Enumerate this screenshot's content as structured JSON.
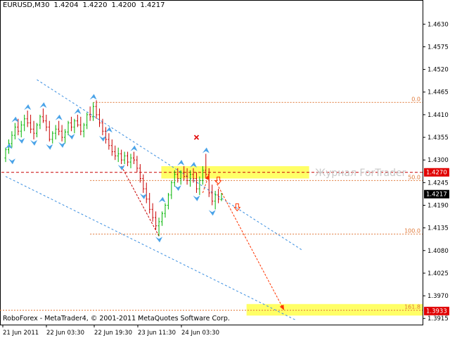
{
  "header": {
    "symbol": "EURUSD,M30",
    "open": "1.4204",
    "high": "1.4220",
    "low": "1.4200",
    "close": "1.4217"
  },
  "footer": {
    "copyright": "RoboForex - MetaTrader4, © 2001-2011 MetaQuotes Software Corp."
  },
  "watermark": "Журнал ForTrader",
  "colors": {
    "up": "#00b400",
    "down": "#c80000",
    "fractal": "#4aa3e8",
    "level": "#e07a3a",
    "channel": "#3a8ee0",
    "arrow": "#ff3300",
    "highlight": "#ffff66"
  },
  "chart_data": {
    "type": "candlestick",
    "y_ticks": [
      "1.4630",
      "1.4575",
      "1.4520",
      "1.4465",
      "1.4410",
      "1.4355",
      "1.4300",
      "1.4245",
      "1.4190",
      "1.4135",
      "1.4080",
      "1.4025",
      "1.3970",
      "1.3915"
    ],
    "ylim": [
      1.39,
      1.4675
    ],
    "x_ticks": [
      "21 Jun 2011",
      "22 Jun 03:30",
      "22 Jun 19:30",
      "23 Jun 11:30",
      "24 Jun 03:30"
    ],
    "price_labels": [
      {
        "value": 1.427,
        "text": "1.4270",
        "style": "red"
      },
      {
        "value": 1.4217,
        "text": "1.4217",
        "style": "black"
      },
      {
        "value": 1.3933,
        "text": "1.3933",
        "style": "red"
      }
    ],
    "fib_levels": [
      {
        "value": 1.444,
        "label": "0.0"
      },
      {
        "value": 1.425,
        "label": "50.0"
      },
      {
        "value": 1.412,
        "label": "100.0"
      },
      {
        "value": 1.3935,
        "label": "161.8"
      }
    ],
    "candles": [
      [
        1.4305,
        1.433,
        1.4295,
        1.4325
      ],
      [
        1.4325,
        1.435,
        1.4315,
        1.434
      ],
      [
        1.434,
        1.437,
        1.433,
        1.436
      ],
      [
        1.436,
        1.439,
        1.435,
        1.438
      ],
      [
        1.438,
        1.44,
        1.436,
        1.437
      ],
      [
        1.437,
        1.4395,
        1.4355,
        1.4385
      ],
      [
        1.4385,
        1.441,
        1.437,
        1.44
      ],
      [
        1.44,
        1.442,
        1.438,
        1.439
      ],
      [
        1.439,
        1.441,
        1.4365,
        1.4375
      ],
      [
        1.4375,
        1.4395,
        1.435,
        1.4365
      ],
      [
        1.4365,
        1.439,
        1.4355,
        1.4385
      ],
      [
        1.4385,
        1.441,
        1.4375,
        1.4405
      ],
      [
        1.4405,
        1.4425,
        1.439,
        1.4395
      ],
      [
        1.4395,
        1.441,
        1.437,
        1.438
      ],
      [
        1.438,
        1.4395,
        1.4345,
        1.435
      ],
      [
        1.435,
        1.437,
        1.434,
        1.4365
      ],
      [
        1.4365,
        1.4385,
        1.435,
        1.4375
      ],
      [
        1.4375,
        1.4395,
        1.436,
        1.437
      ],
      [
        1.437,
        1.4385,
        1.4345,
        1.4355
      ],
      [
        1.4355,
        1.4375,
        1.434,
        1.4368
      ],
      [
        1.4368,
        1.4395,
        1.436,
        1.439
      ],
      [
        1.439,
        1.4405,
        1.437,
        1.438
      ],
      [
        1.438,
        1.44,
        1.4365,
        1.4395
      ],
      [
        1.4395,
        1.441,
        1.438,
        1.4385
      ],
      [
        1.4385,
        1.4405,
        1.436,
        1.437
      ],
      [
        1.437,
        1.439,
        1.4355,
        1.4385
      ],
      [
        1.4385,
        1.4415,
        1.4375,
        1.441
      ],
      [
        1.441,
        1.443,
        1.4395,
        1.4405
      ],
      [
        1.4405,
        1.444,
        1.4395,
        1.443
      ],
      [
        1.443,
        1.4445,
        1.44,
        1.441
      ],
      [
        1.441,
        1.4425,
        1.438,
        1.439
      ],
      [
        1.439,
        1.44,
        1.436,
        1.437
      ],
      [
        1.437,
        1.438,
        1.434,
        1.435
      ],
      [
        1.435,
        1.4365,
        1.4325,
        1.4335
      ],
      [
        1.4335,
        1.435,
        1.431,
        1.432
      ],
      [
        1.432,
        1.4335,
        1.43,
        1.431
      ],
      [
        1.431,
        1.433,
        1.4295,
        1.4315
      ],
      [
        1.4315,
        1.4325,
        1.429,
        1.43
      ],
      [
        1.43,
        1.432,
        1.429,
        1.431
      ],
      [
        1.431,
        1.432,
        1.4285,
        1.4295
      ],
      [
        1.4295,
        1.4315,
        1.428,
        1.4305
      ],
      [
        1.4305,
        1.432,
        1.429,
        1.43
      ],
      [
        1.43,
        1.431,
        1.427,
        1.428
      ],
      [
        1.428,
        1.429,
        1.4245,
        1.4255
      ],
      [
        1.4255,
        1.4265,
        1.422,
        1.423
      ],
      [
        1.423,
        1.4245,
        1.4195,
        1.4205
      ],
      [
        1.4205,
        1.422,
        1.417,
        1.418
      ],
      [
        1.418,
        1.4195,
        1.415,
        1.416
      ],
      [
        1.416,
        1.4175,
        1.413,
        1.414
      ],
      [
        1.414,
        1.416,
        1.4115,
        1.415
      ],
      [
        1.415,
        1.4175,
        1.414,
        1.417
      ],
      [
        1.417,
        1.4195,
        1.416,
        1.419
      ],
      [
        1.419,
        1.422,
        1.418,
        1.4215
      ],
      [
        1.4215,
        1.425,
        1.4205,
        1.4245
      ],
      [
        1.4245,
        1.4275,
        1.4235,
        1.4265
      ],
      [
        1.4265,
        1.428,
        1.4245,
        1.4255
      ],
      [
        1.4255,
        1.4275,
        1.424,
        1.427
      ],
      [
        1.427,
        1.4285,
        1.425,
        1.426
      ],
      [
        1.426,
        1.428,
        1.424,
        1.425
      ],
      [
        1.425,
        1.4275,
        1.4235,
        1.4265
      ],
      [
        1.4265,
        1.428,
        1.4245,
        1.4255
      ],
      [
        1.4255,
        1.427,
        1.422,
        1.423
      ],
      [
        1.423,
        1.426,
        1.4215,
        1.425
      ],
      [
        1.425,
        1.4285,
        1.424,
        1.4275
      ],
      [
        1.4275,
        1.4315,
        1.4255,
        1.4265
      ],
      [
        1.4265,
        1.428,
        1.421,
        1.422
      ],
      [
        1.422,
        1.424,
        1.419,
        1.42
      ],
      [
        1.42,
        1.4225,
        1.418,
        1.4215
      ],
      [
        1.4215,
        1.423,
        1.4195,
        1.4205
      ],
      [
        1.4204,
        1.422,
        1.42,
        1.4217
      ]
    ],
    "fractals_up": [
      [
        1,
        1.433
      ],
      [
        3,
        1.4395
      ],
      [
        7,
        1.4425
      ],
      [
        12,
        1.443
      ],
      [
        17,
        1.44
      ],
      [
        23,
        1.4415
      ],
      [
        28,
        1.445
      ],
      [
        33,
        1.437
      ],
      [
        41,
        1.4325
      ],
      [
        50,
        1.42
      ],
      [
        56,
        1.429
      ],
      [
        60,
        1.4285
      ],
      [
        64,
        1.432
      ]
    ],
    "fractals_down": [
      [
        2,
        1.43
      ],
      [
        5,
        1.435
      ],
      [
        9,
        1.4345
      ],
      [
        14,
        1.4335
      ],
      [
        18,
        1.434
      ],
      [
        21,
        1.436
      ],
      [
        31,
        1.4355
      ],
      [
        37,
        1.4285
      ],
      [
        44,
        1.4215
      ],
      [
        49,
        1.411
      ],
      [
        55,
        1.4235
      ],
      [
        61,
        1.421
      ],
      [
        66,
        1.4175
      ]
    ],
    "channel_upper": [
      [
        10,
        1.4495
      ],
      [
        95,
        1.408
      ]
    ],
    "channel_lower": [
      [
        0,
        1.426
      ],
      [
        93,
        1.391
      ]
    ],
    "arrows": [
      {
        "from": [
          63,
          1.422
        ],
        "to": [
          65,
          1.4265
        ]
      },
      {
        "from": [
          67,
          1.425
        ],
        "to": [
          89,
          1.3935
        ]
      }
    ],
    "hollow_arrows": [
      [
        68,
        1.425
      ],
      [
        74,
        1.4185
      ]
    ],
    "cross": [
      61,
      1.4355
    ]
  }
}
